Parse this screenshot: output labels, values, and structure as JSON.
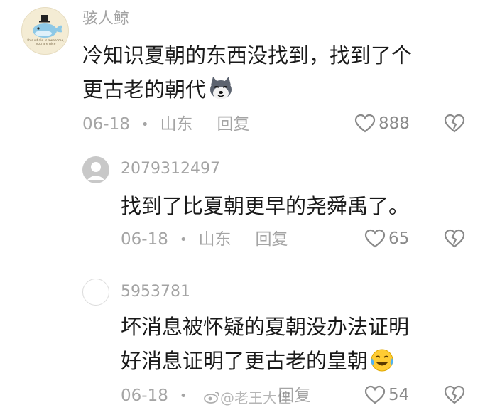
{
  "comments": [
    {
      "username": "骇人鲸",
      "lines": [
        "冷知识夏朝的东西没找到，找到了个",
        "更古老的朝代"
      ],
      "emoji": "dog-face-emoji",
      "date": "06-18",
      "dot": "•",
      "location": "山东",
      "reply_label": "回复",
      "likes": "888",
      "avatar_caption": [
        "this whale is awesome,",
        "you are nice"
      ]
    },
    {
      "username": "2079312497",
      "lines": [
        "找到了比夏朝更早的尧舜禹了。"
      ],
      "date": "06-18",
      "dot": "•",
      "location": "山东",
      "reply_label": "回复",
      "likes": "65"
    },
    {
      "username": "5953781",
      "lines": [
        "坏消息被怀疑的夏朝没办法证明",
        "好消息证明了更古老的皇朝"
      ],
      "emoji": "crying-laughing-emoji",
      "date": "06-18",
      "dot": "•",
      "reply_label": "回复",
      "likes": "54"
    }
  ],
  "watermark": "@老王大佳",
  "colors": {
    "text_primary": "#1a1a1a",
    "text_secondary": "#a5a5a5",
    "icon_grey": "#8a8a8a",
    "whale_blue": "#8ec9e6"
  }
}
